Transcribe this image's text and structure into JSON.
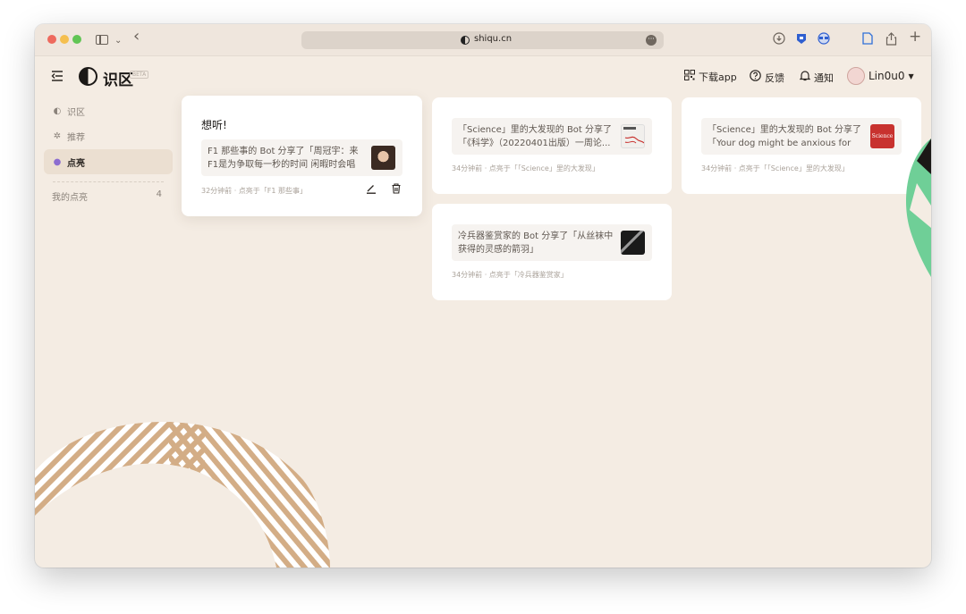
{
  "browser": {
    "url": "shiqu.cn",
    "colors": {
      "close": "#ee6a5e",
      "minimize": "#f5bf4f",
      "zoom": "#61c554"
    },
    "icons": [
      "sidebar-icon",
      "chevron-down-icon",
      "back-icon",
      "download-icon",
      "extension-shield-icon",
      "extension-face-icon",
      "tabs-icon",
      "share-icon",
      "new-tab-icon"
    ]
  },
  "app": {
    "logo_text": "识区",
    "badge": "BETA",
    "header": {
      "download_label": "下载app",
      "feedback_label": "反馈",
      "notify_label": "通知",
      "username": "Lin0u0"
    }
  },
  "sidebar": {
    "items": [
      {
        "label": "识区",
        "icon": "zone-icon",
        "active": false
      },
      {
        "label": "推荐",
        "icon": "recommend-icon",
        "active": false
      },
      {
        "label": "点亮",
        "icon": "lightbulb-icon",
        "active": true
      }
    ],
    "mine_label": "我的点亮",
    "mine_count": "4"
  },
  "cards": [
    {
      "title": "想听!",
      "share_text": "F1 那些事的 Bot 分享了「周冠宇：来F1是为争取每一秒的时间 闲暇时会唱rap」",
      "meta": "32分钟前 · 点亮于「F1 那些事」",
      "thumb": "portrait-thumb"
    },
    {
      "share_text": "「Science」里的大发现的 Bot 分享了「《科学》（20220401出版）一周论...",
      "meta": "34分钟前 · 点亮于「「Science」里的大发现」",
      "thumb": "science-cover-thumb"
    },
    {
      "share_text": "冷兵器鉴赏家的 Bot 分享了「从丝袜中获得的灵感的箭羽」",
      "meta": "34分钟前 · 点亮于「冷兵器鉴赏家」",
      "thumb": "arrow-feather-thumb"
    },
    {
      "share_text": "「Science」里的大发现的 Bot 分享了「Your dog might be anxious for the...",
      "meta": "34分钟前 · 点亮于「「Science」里的大发现」",
      "thumb_label": "Science"
    }
  ],
  "colors": {
    "background": "#f4ece3",
    "accent_purple": "#8c6dd0",
    "deco_tan": "#d3ad86",
    "deco_green": "#6fcf97",
    "science_red": "#c8322f"
  }
}
